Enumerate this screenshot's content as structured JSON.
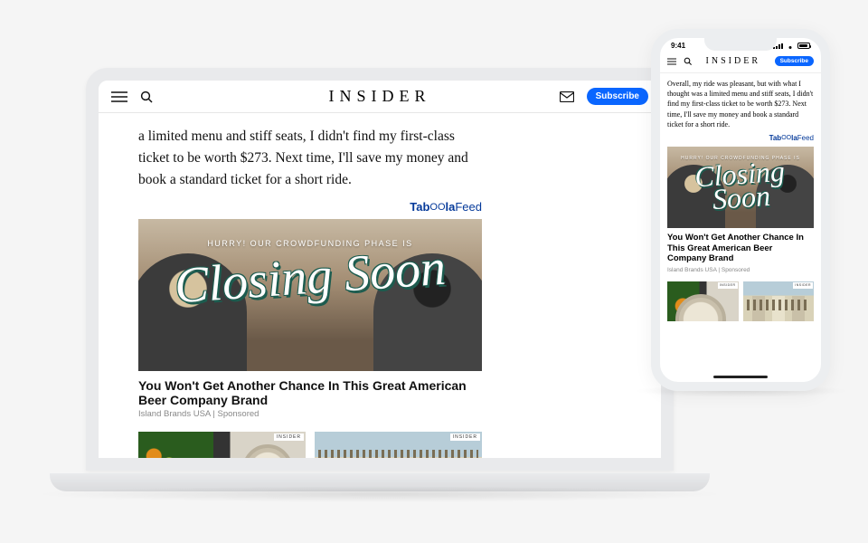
{
  "brand": "INSIDER",
  "laptop": {
    "subscribe_label": "Subscribe",
    "article_paragraph": "a limited menu and stiff seats, I didn't find my first-class ticket to be worth $273. Next time, I'll save my money and book a standard ticket for a short ride.",
    "taboola_label_bold": "Tab",
    "taboola_label_bold2": "la",
    "taboola_label_thin1": "OO",
    "taboola_label_thin2": "Feed",
    "ad": {
      "overlay_top": "HURRY! OUR CROWDFUNDING PHASE IS",
      "script_text": "Closing Soon",
      "title": "You Won't Get Another Chance In This Great American Beer Company Brand",
      "byline": "Island Brands USA | Sponsored"
    },
    "thumb_corner": "INSIDER"
  },
  "phone": {
    "status_time": "9:41",
    "subscribe_label": "Subscribe",
    "article_paragraph": "Overall, my ride was pleasant, but with what I thought was a limited menu and stiff seats, I didn't find my first-class ticket to be worth $273. Next time, I'll save my money and book a standard ticket for a short ride.",
    "taboola_label_bold": "Tab",
    "taboola_label_bold2": "la",
    "taboola_label_thin1": "OO",
    "taboola_label_thin2": "Feed",
    "ad": {
      "overlay_top": "HURRY! OUR CROWDFUNDING PHASE IS",
      "script_text": "Closing Soon",
      "title": "You Won't Get Another Chance In This Great American Beer Company Brand",
      "byline": "Island Brands USA | Sponsored"
    },
    "thumb_corner": "INSIDER"
  }
}
